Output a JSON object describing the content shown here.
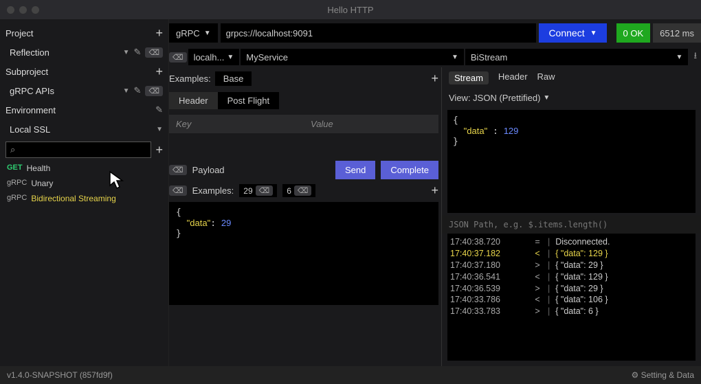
{
  "title": "Hello HTTP",
  "sidebar": {
    "project_label": "Project",
    "project_value": "Reflection",
    "subproject_label": "Subproject",
    "subproject_value": "gRPC APIs",
    "env_label": "Environment",
    "env_value": "Local SSL",
    "requests": [
      {
        "method": "GET",
        "label": "Health",
        "method_class": "method-get"
      },
      {
        "method": "gRPC",
        "label": "Unary",
        "method_class": "method-grpc"
      },
      {
        "method": "gRPC",
        "label": "Bidirectional Streaming",
        "method_class": "method-grpc",
        "highlight": true
      }
    ]
  },
  "top": {
    "protocol": "gRPC",
    "url": "grpcs://localhost:9091",
    "connect": "Connect",
    "status": "0 OK",
    "latency": "6512 ms",
    "host": "localh...",
    "service": "MyService",
    "method": "BiStream"
  },
  "examples": {
    "label": "Examples:",
    "base": "Base",
    "tabs": [
      "Header",
      "Post Flight"
    ],
    "key_ph": "Key",
    "val_ph": "Value"
  },
  "payload": {
    "label": "Payload",
    "send": "Send",
    "complete": "Complete",
    "examples_label": "Examples:",
    "chips": [
      "29",
      "6"
    ],
    "body": {
      "key": "data",
      "val": "29"
    }
  },
  "response": {
    "tabs": [
      "Stream",
      "Header",
      "Raw"
    ],
    "view_label": "View: JSON (Prettified)",
    "body": {
      "key": "data",
      "val": "129"
    },
    "jsonpath_ph": "JSON Path, e.g. $.items.length()",
    "log": [
      {
        "ts": "17:40:38.720",
        "dir": "=",
        "msg": "Disconnected."
      },
      {
        "ts": "17:40:37.182",
        "dir": "<",
        "msg": "{ \"data\": 129 }",
        "yl": true
      },
      {
        "ts": "17:40:37.180",
        "dir": ">",
        "msg": "{ \"data\": 29 }"
      },
      {
        "ts": "17:40:36.541",
        "dir": "<",
        "msg": "{ \"data\": 129 }"
      },
      {
        "ts": "17:40:36.539",
        "dir": ">",
        "msg": "{ \"data\": 29 }"
      },
      {
        "ts": "17:40:33.786",
        "dir": "<",
        "msg": "{ \"data\": 106 }"
      },
      {
        "ts": "17:40:33.783",
        "dir": ">",
        "msg": "{ \"data\": 6 }"
      }
    ]
  },
  "footer": {
    "version": "v1.4.0-SNAPSHOT (857fd9f)",
    "settings": "Setting & Data"
  }
}
